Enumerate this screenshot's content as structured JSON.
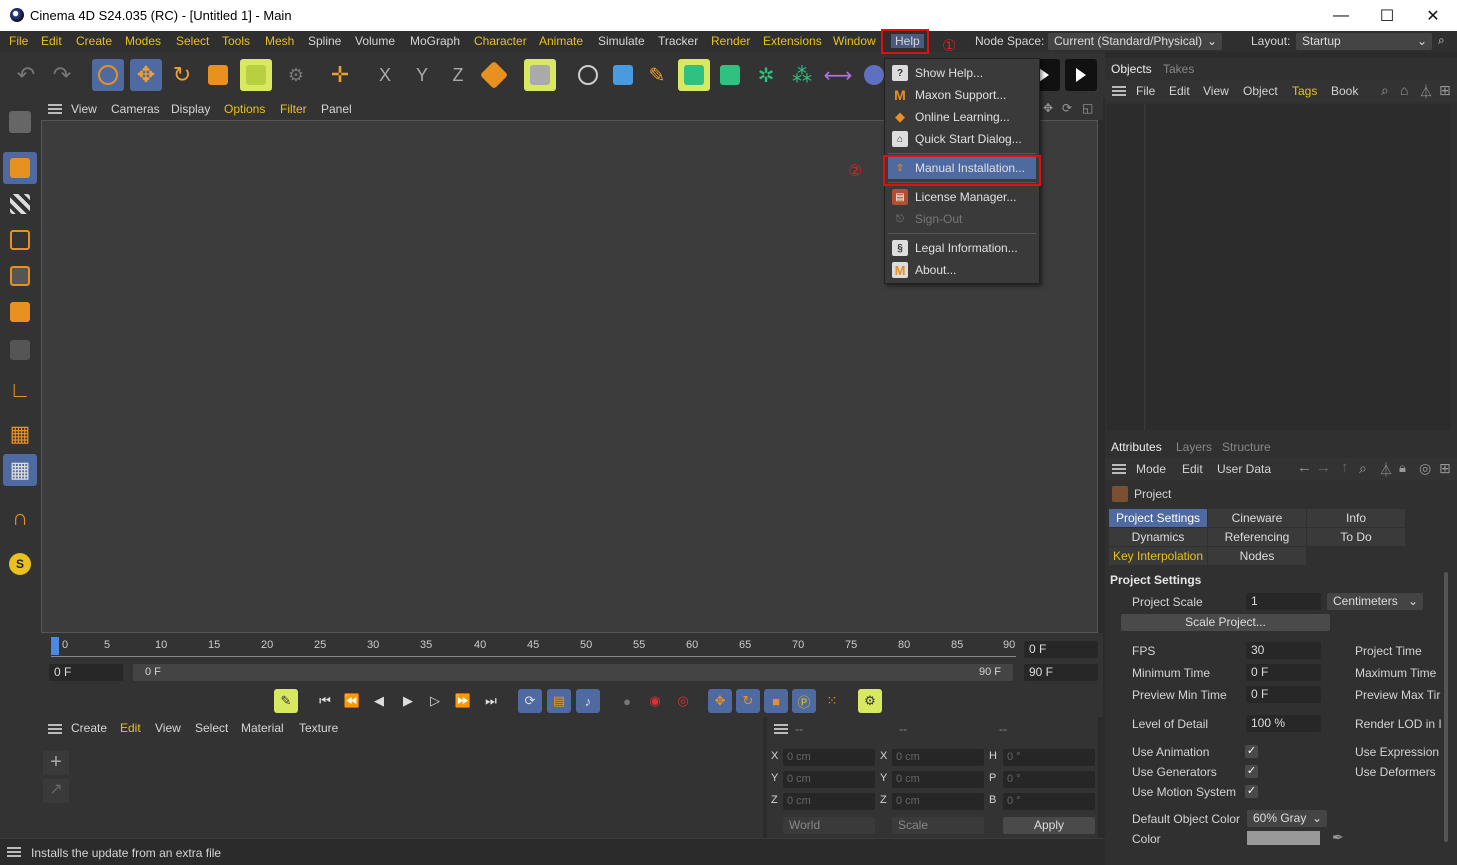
{
  "window": {
    "title": "Cinema 4D S24.035 (RC) - [Untitled 1] - Main",
    "minimize": "—",
    "maximize": "☐",
    "close": "✕"
  },
  "menubar": {
    "items": [
      "File",
      "Edit",
      "Create",
      "Modes",
      "Select",
      "Tools",
      "Mesh",
      "Spline",
      "Volume",
      "MoGraph",
      "Character",
      "Animate",
      "Simulate",
      "Tracker",
      "Render",
      "Extensions",
      "Window",
      "Help"
    ],
    "node_space_label": "Node Space:",
    "node_space_value": "Current (Standard/Physical)",
    "layout_label": "Layout:",
    "layout_value": "Startup"
  },
  "annotations": {
    "step1": "①",
    "step2": "②"
  },
  "help_menu": {
    "items": [
      {
        "label": "Show Help...",
        "icon": "help-book-icon"
      },
      {
        "label": "Maxon Support...",
        "icon": "maxon-m-icon"
      },
      {
        "label": "Online Learning...",
        "icon": "graduation-cap-icon"
      },
      {
        "label": "Quick Start Dialog...",
        "icon": "home-icon"
      },
      {
        "label": "Manual Installation...",
        "icon": "install-upload-icon"
      },
      {
        "label": "License Manager...",
        "icon": "license-icon"
      },
      {
        "label": "Sign-Out",
        "icon": "signout-icon"
      },
      {
        "label": "Legal Information...",
        "icon": "legal-icon"
      },
      {
        "label": "About...",
        "icon": "maxon-about-icon"
      }
    ]
  },
  "viewport_menu": {
    "items": [
      "View",
      "Cameras",
      "Display",
      "Options",
      "Filter",
      "Panel"
    ]
  },
  "timeline": {
    "ticks": [
      "0",
      "5",
      "10",
      "15",
      "20",
      "25",
      "30",
      "35",
      "40",
      "45",
      "50",
      "55",
      "60",
      "65",
      "70",
      "75",
      "80",
      "85",
      "90"
    ],
    "current_frame": "0 F",
    "end_frame": "90 F",
    "min_field": "0 F",
    "range_start": "0 F",
    "range_end": "90 F",
    "max_field": "90 F"
  },
  "material_menu": {
    "items": [
      "Create",
      "Edit",
      "View",
      "Select",
      "Material",
      "Texture"
    ]
  },
  "coords": {
    "header": [
      "--",
      "--",
      "--"
    ],
    "x": "0 cm",
    "y": "0 cm",
    "z": "0 cm",
    "sx": "0 cm",
    "sy": "0 cm",
    "sz": "0 cm",
    "h": "0 °",
    "p": "0 °",
    "b": "0 °",
    "row_labels": [
      "X",
      "Y",
      "Z"
    ],
    "mid_labels": [
      "X",
      "Y",
      "Z"
    ],
    "rot_labels": [
      "H",
      "P",
      "B"
    ],
    "world": "World",
    "scale": "Scale",
    "apply": "Apply"
  },
  "status": {
    "text": "Installs the update from an extra file"
  },
  "objects_panel": {
    "tabs": [
      "Objects",
      "Takes"
    ],
    "menu": [
      "File",
      "Edit",
      "View",
      "Object",
      "Tags",
      "Book"
    ]
  },
  "attributes_panel": {
    "tabs": [
      "Attributes",
      "Layers",
      "Structure"
    ],
    "menu": [
      "Mode",
      "Edit",
      "User Data"
    ],
    "object": "Project",
    "subtabs": [
      "Project Settings",
      "Cineware",
      "Info",
      "Dynamics",
      "Referencing",
      "To Do",
      "Key Interpolation",
      "Nodes"
    ],
    "section": "Project Settings",
    "project_scale_label": "Project Scale",
    "project_scale_value": "1",
    "project_scale_unit": "Centimeters",
    "scale_project_btn": "Scale Project...",
    "fps_label": "FPS",
    "fps_value": "30",
    "project_time_label": "Project Time",
    "min_time_label": "Minimum Time",
    "min_time_value": "0 F",
    "max_time_label": "Maximum Time",
    "prev_min_label": "Preview Min Time",
    "prev_min_value": "0 F",
    "prev_max_label": "Preview Max Tir",
    "lod_label": "Level of Detail",
    "lod_value": "100 %",
    "render_lod_label": "Render LOD in I",
    "use_animation": "Use Animation",
    "use_expression": "Use Expression",
    "use_generators": "Use Generators",
    "use_deformers": "Use Deformers",
    "use_motion": "Use Motion System",
    "check": "✓",
    "default_color_label": "Default Object Color",
    "default_color_value": "60% Gray",
    "color_label": "Color"
  }
}
